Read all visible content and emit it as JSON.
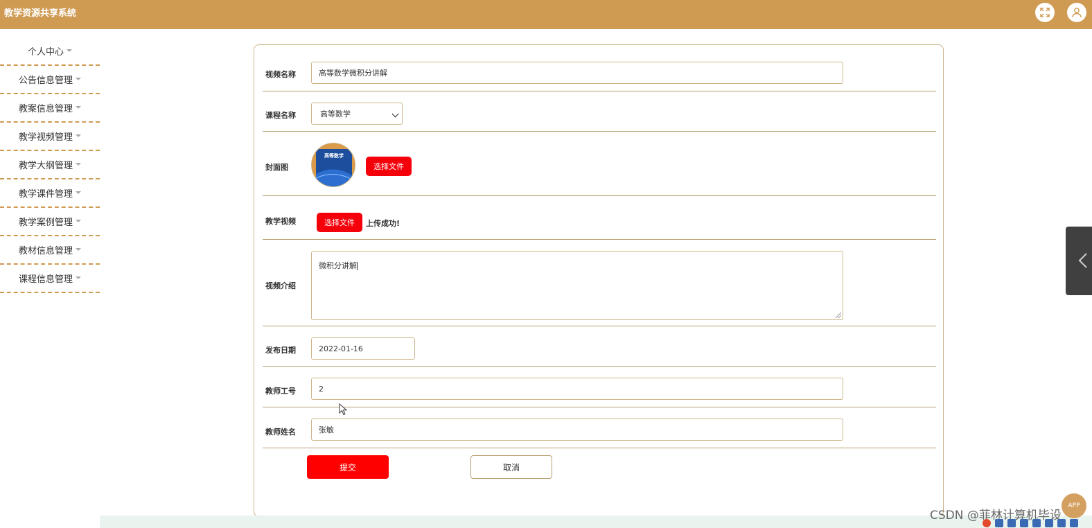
{
  "header": {
    "title": "教学资源共享系统",
    "icons": [
      "fullscreen-icon",
      "user-icon"
    ]
  },
  "sidebar": {
    "items": [
      {
        "label": "个人中心"
      },
      {
        "label": "公告信息管理"
      },
      {
        "label": "教案信息管理"
      },
      {
        "label": "教学视频管理"
      },
      {
        "label": "教学大纲管理"
      },
      {
        "label": "教学课件管理"
      },
      {
        "label": "教学案例管理"
      },
      {
        "label": "教材信息管理"
      },
      {
        "label": "课程信息管理"
      }
    ]
  },
  "form": {
    "video_name": {
      "label": "视频名称",
      "value": "高等数学微积分讲解"
    },
    "course_name": {
      "label": "课程名称",
      "value": "高等数学"
    },
    "cover": {
      "label": "封面图",
      "button": "选择文件",
      "cover_title": "高等数学"
    },
    "video": {
      "label": "教学视频",
      "button": "选择文件",
      "status": "上传成功!"
    },
    "intro": {
      "label": "视频介绍",
      "value": "微积分讲解"
    },
    "publish_date": {
      "label": "发布日期",
      "value": "2022-01-16"
    },
    "teacher_id": {
      "label": "教师工号",
      "value": "2"
    },
    "teacher_name": {
      "label": "教师姓名",
      "value": "张敏"
    },
    "submit_label": "提交",
    "cancel_label": "取消"
  },
  "overlay": {
    "watermark": "CSDN @菲林计算机毕设",
    "app_badge": "APP"
  },
  "colors": {
    "brand": "#cf9a52",
    "accent_red": "#f5000a",
    "border": "#cdb48a"
  }
}
